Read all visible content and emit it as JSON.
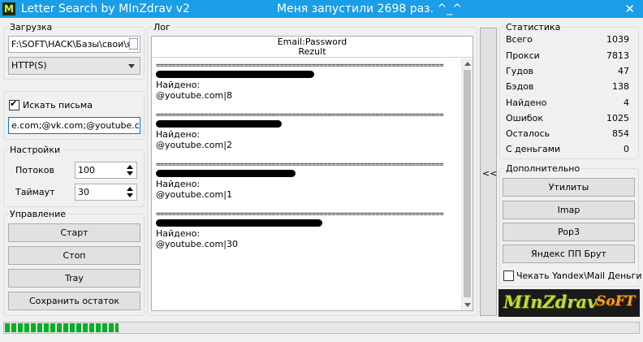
{
  "window": {
    "title": "Letter Search by MInZdrav v2",
    "subtitle": "Меня запустили 2698 раз. ^_^",
    "close_glyph": "✕",
    "icon_letter": "M"
  },
  "load_group": {
    "legend": "Загрузка",
    "file_path": "F:\\SOFT\\HACK\\Базы\\свои\\яд",
    "proxy_type": "HTTP(S)"
  },
  "search": {
    "checkbox_label": "Искать письма",
    "checked": true,
    "domains": "e.com;@vk.com;@youtube.com"
  },
  "settings": {
    "legend": "Настройки",
    "threads_label": "Потоков",
    "threads_value": "100",
    "timeout_label": "Таймаут",
    "timeout_value": "30"
  },
  "control": {
    "legend": "Управление",
    "start": "Старт",
    "stop": "Стоп",
    "tray": "Tray",
    "save_rest": "Сохранить остаток"
  },
  "log": {
    "legend": "Лог",
    "header_line1": "Email:Password",
    "header_line2": "Rezult",
    "separator": "========================================================================",
    "entries": [
      {
        "found_label": "Найдено:",
        "result": "@youtube.com|8"
      },
      {
        "found_label": "Найдено:",
        "result": "@youtube.com|2"
      },
      {
        "found_label": "Найдено:",
        "result": "@youtube.com|1"
      },
      {
        "found_label": "Найдено:",
        "result": "@youtube.com|30"
      }
    ]
  },
  "toggle_panel": {
    "label": "<<"
  },
  "stats": {
    "legend": "Статистика",
    "rows": [
      {
        "label": "Всего",
        "value": "1039"
      },
      {
        "label": "Прокси",
        "value": "7813"
      },
      {
        "label": "Гудов",
        "value": "47"
      },
      {
        "label": "Бэдов",
        "value": "138"
      },
      {
        "label": "Найдено",
        "value": "4"
      },
      {
        "label": "Ошибок",
        "value": "1025"
      },
      {
        "label": "Осталось",
        "value": "854"
      },
      {
        "label": "С деньгами",
        "value": "0"
      }
    ]
  },
  "extra": {
    "legend": "Дополнительно",
    "utilities": "Утилиты",
    "imap": "Imap",
    "pop3": "Pop3",
    "yandex_brute": "Яндекс ПП Брут",
    "money_check_label": "Чекать Yandex\\Mail Деньги",
    "money_check_checked": false
  },
  "logo": {
    "part1": "MInZdrav",
    "part2": "SoFT"
  },
  "progress": {
    "fraction": 0.18,
    "color": "#06b025"
  }
}
